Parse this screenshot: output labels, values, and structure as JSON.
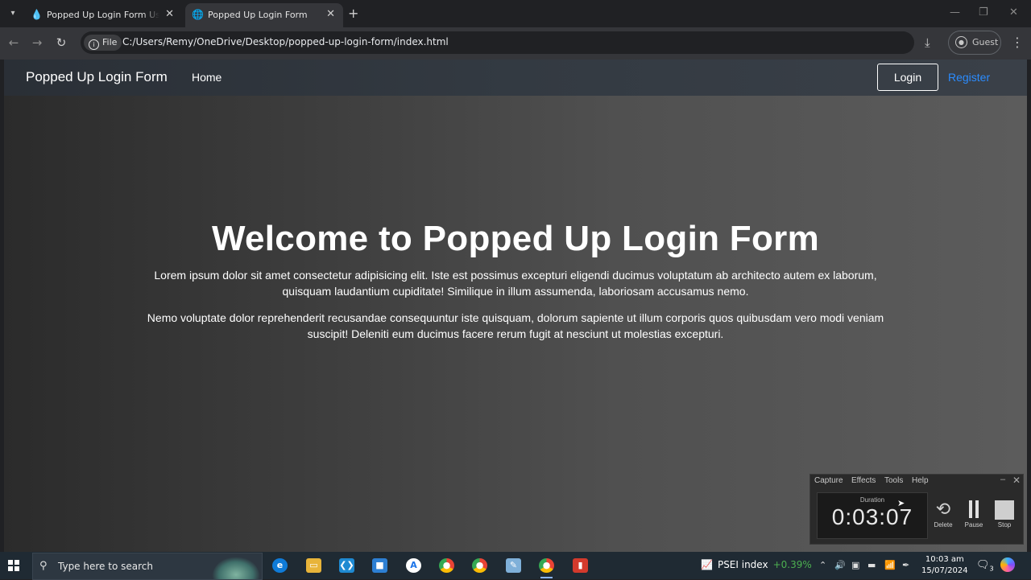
{
  "browser": {
    "tabs": [
      {
        "title": "Popped Up Login Form Using H",
        "icon": "drupal-icon",
        "active": false
      },
      {
        "title": "Popped Up Login Form",
        "icon": "globe-icon",
        "active": true
      }
    ],
    "address": {
      "chip_label": "File",
      "url": "C:/Users/Remy/OneDrive/Desktop/popped-up-login-form/index.html"
    },
    "profile_label": "Guest"
  },
  "page": {
    "brand": "Popped Up Login Form",
    "nav_home": "Home",
    "login_label": "Login",
    "register_label": "Register",
    "hero": {
      "title": "Welcome to Popped Up Login Form",
      "paragraph1": "Lorem ipsum dolor sit amet consectetur adipisicing elit. Iste est possimus excepturi eligendi ducimus voluptatum ab architecto autem ex laborum, quisquam laudantium cupiditate! Similique in illum assumenda, laboriosam accusamus nemo.",
      "paragraph2": "Nemo voluptate dolor reprehenderit recusandae consequuntur iste quisquam, dolorum sapiente ut illum corporis quos quibusdam vero modi veniam suscipit! Deleniti eum ducimus facere rerum fugit at nesciunt ut molestias excepturi."
    },
    "colors": {
      "register_link": "#2b8cff",
      "navbar_bg": "#333a42"
    }
  },
  "recorder": {
    "menu": [
      "Capture",
      "Effects",
      "Tools",
      "Help"
    ],
    "duration_label": "Duration",
    "duration": "0:03:07",
    "delete_label": "Delete",
    "pause_label": "Pause",
    "stop_label": "Stop"
  },
  "taskbar": {
    "search_placeholder": "Type here to search",
    "stock_name": "PSEI index",
    "stock_change": "+0.39%",
    "time": "10:03 am",
    "date": "15/07/2024",
    "notification_count": "3"
  }
}
